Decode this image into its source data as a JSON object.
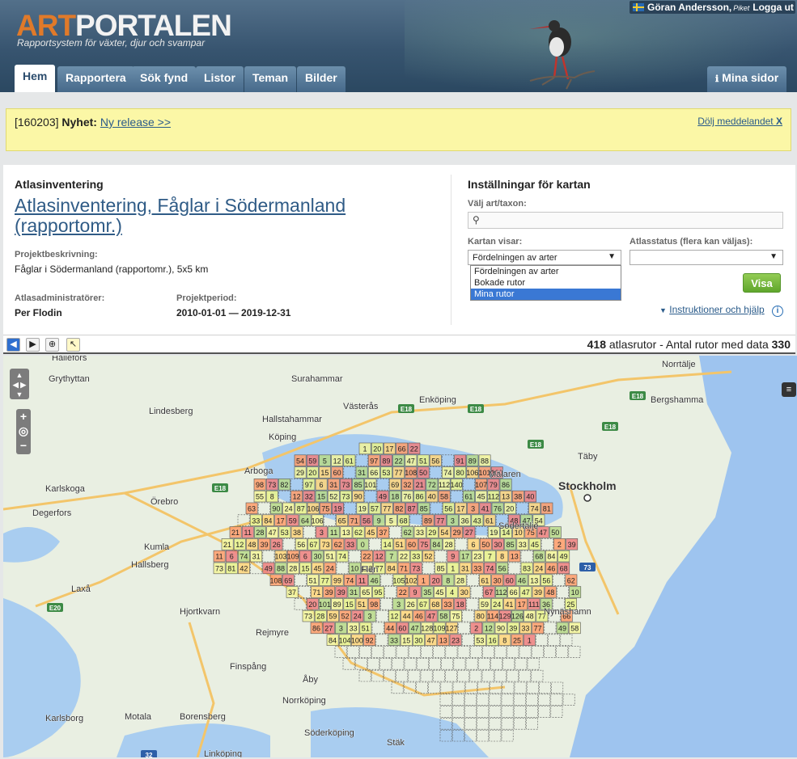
{
  "header": {
    "logo_part1": "ART",
    "logo_part2": "PORTALEN",
    "tagline": "Rapportsystem för växter, djur och svampar",
    "user_name": "Göran Andersson,",
    "user_signature": "Piket",
    "logout": "Logga ut"
  },
  "nav": {
    "tabs": [
      {
        "label": "Hem",
        "active": true
      },
      {
        "label": "Rapportera"
      },
      {
        "label": "Sök fynd"
      },
      {
        "label": "Listor"
      },
      {
        "label": "Teman"
      },
      {
        "label": "Bilder"
      }
    ],
    "mina_sidor": "Mina sidor"
  },
  "notice": {
    "prefix": "[160203]",
    "label": "Nyhet:",
    "link": "Ny release >>",
    "hide": "Dölj meddelandet",
    "hide_x": "X"
  },
  "project": {
    "heading": "Atlasinventering",
    "title": "Atlasinventering, Fåglar i Södermanland (rapportomr.)",
    "desc_label": "Projektbeskrivning:",
    "desc": "Fåglar i Södermanland (rapportomr.), 5x5 km",
    "admin_label": "Atlasadministratörer:",
    "admin": "Per Flodin",
    "period_label": "Projektperiod:",
    "period": "2010-01-01 — 2019-12-31"
  },
  "settings": {
    "heading": "Inställningar för kartan",
    "taxon_label": "Välj art/taxon:",
    "taxon_value": "",
    "shows_label": "Kartan visar:",
    "shows_value": "Fördelningen av arter",
    "shows_options": [
      "Fördelningen av arter",
      "Bokade rutor",
      "Mina rutor"
    ],
    "shows_highlighted": "Mina rutor",
    "status_label": "Atlasstatus (flera kan väljas):",
    "status_value": "",
    "button": "Visa",
    "help": "Instruktioner och hjälp"
  },
  "stats": {
    "count": "418",
    "count_label": "atlasrutor - Antal rutor med data",
    "with_data": "330"
  },
  "map": {
    "places": [
      "Hallefors",
      "Grythyttan",
      "Lindesberg",
      "Surahammar",
      "Västerås",
      "Enköping",
      "Hallstahammar",
      "Köping",
      "Arboga",
      "Karlskoga",
      "Degerfors",
      "Örebro",
      "Kumla",
      "Hallsberg",
      "Laxå",
      "Hjortkvarn",
      "Rejmyre",
      "Finspång",
      "Åby",
      "Norrköping",
      "Motala",
      "Borensberg",
      "Karlsborg",
      "Söderköping",
      "Linköping",
      "Stäk",
      "Flen",
      "Stockholm",
      "Täby",
      "Södertälje",
      "Nynäshamn",
      "Norrtälje",
      "Bergshamma",
      "Mälaren"
    ],
    "roads": [
      "E18",
      "E18",
      "E18",
      "E18",
      "E20",
      "73",
      "32",
      "E18",
      "E18"
    ],
    "grid_numbers": [
      "1",
      "20",
      "17",
      "66",
      "22",
      "54",
      "59",
      "5",
      "12",
      "61",
      "97",
      "89",
      "22",
      "47",
      "51",
      "56",
      "91",
      "89",
      "88",
      "29",
      "20",
      "15",
      "60",
      "31",
      "66",
      "53",
      "77",
      "108",
      "50",
      "74",
      "80",
      "106",
      "101",
      "100",
      "98",
      "73",
      "82",
      "97",
      "6",
      "31",
      "73",
      "85",
      "101",
      "69",
      "32",
      "21",
      "72",
      "112",
      "140",
      "107",
      "79",
      "86",
      "55",
      "8",
      "12",
      "32",
      "15",
      "52",
      "73",
      "90",
      "49",
      "18",
      "76",
      "86",
      "40",
      "58",
      "61",
      "45",
      "112",
      "13",
      "38",
      "40",
      "63",
      "90",
      "24",
      "87",
      "106",
      "75",
      "19",
      "19",
      "57",
      "77",
      "82",
      "87",
      "85",
      "56",
      "17",
      "3",
      "41",
      "76",
      "20",
      "74",
      "81",
      "33",
      "84",
      "17",
      "59",
      "64",
      "106",
      "65",
      "71",
      "56",
      "9",
      "5",
      "68",
      "89",
      "77",
      "3",
      "36",
      "43",
      "61",
      "48",
      "47",
      "54",
      "21",
      "11",
      "28",
      "47",
      "53",
      "38",
      "3",
      "11",
      "13",
      "62",
      "45",
      "37",
      "62",
      "33",
      "29",
      "54",
      "29",
      "27",
      "19",
      "14",
      "10",
      "75",
      "47",
      "50",
      "21",
      "12",
      "48",
      "39",
      "26",
      "56",
      "67",
      "73",
      "62",
      "33",
      "0",
      "14",
      "51",
      "60",
      "75",
      "84",
      "28",
      "6",
      "50",
      "30",
      "85",
      "33",
      "45",
      "2",
      "39",
      "11",
      "6",
      "74",
      "31",
      "103",
      "109",
      "6",
      "30",
      "51",
      "74",
      "22",
      "12",
      "7",
      "22",
      "33",
      "52",
      "9",
      "17",
      "23",
      "7",
      "8",
      "13",
      "68",
      "84",
      "49",
      "73",
      "81",
      "42",
      "49",
      "88",
      "28",
      "15",
      "45",
      "24",
      "10",
      "112",
      "77",
      "84",
      "71",
      "73",
      "85",
      "1",
      "31",
      "33",
      "74",
      "56",
      "83",
      "24",
      "46",
      "68",
      "108",
      "69",
      "51",
      "77",
      "99",
      "74",
      "11",
      "46",
      "105",
      "102",
      "1",
      "20",
      "8",
      "28",
      "61",
      "30",
      "60",
      "46",
      "13",
      "56",
      "62",
      "37",
      "71",
      "39",
      "39",
      "31",
      "65",
      "95",
      "22",
      "9",
      "35",
      "45",
      "4",
      "30",
      "67",
      "112",
      "66",
      "47",
      "39",
      "48",
      "10",
      "20",
      "101",
      "89",
      "15",
      "51",
      "98",
      "3",
      "26",
      "67",
      "68",
      "33",
      "18",
      "59",
      "24",
      "41",
      "17",
      "111",
      "36",
      "25",
      "73",
      "28",
      "59",
      "52",
      "24",
      "3",
      "12",
      "44",
      "46",
      "47",
      "58",
      "75",
      "80",
      "114",
      "129",
      "126",
      "48",
      "77",
      "66",
      "86",
      "27",
      "3",
      "33",
      "51",
      "44",
      "60",
      "47",
      "128",
      "109",
      "127",
      "2",
      "12",
      "90",
      "39",
      "33",
      "77",
      "49",
      "58",
      "84",
      "104",
      "100",
      "92",
      "33",
      "15",
      "30",
      "47",
      "13",
      "23",
      "53",
      "16",
      "8",
      "25",
      "1"
    ]
  }
}
